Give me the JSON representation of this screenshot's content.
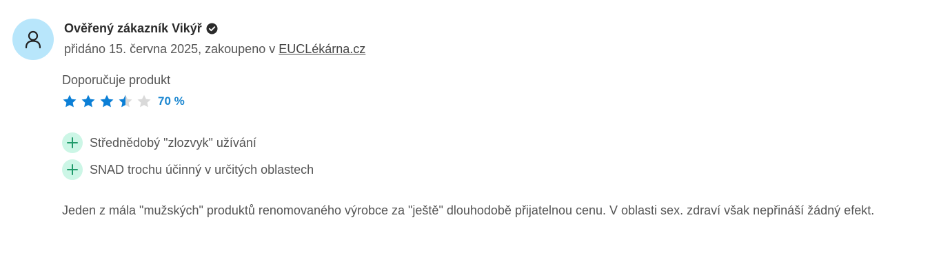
{
  "review": {
    "author": "Ověřený zákazník Vikýř",
    "meta_prefix": "přidáno 15. června 2025, zakoupeno v ",
    "store_link": "EUCLékárna.cz",
    "recommend_label": "Doporučuje produkt",
    "rating": {
      "stars_total": 5,
      "fraction": 0.7,
      "percent_label": "70 %",
      "filled_color": "#0b7fd6",
      "empty_color": "#d9d9d9"
    },
    "pros": [
      {
        "text": "Střednědobý \"zlozvyk\" užívání"
      },
      {
        "text": "SNAD trochu účinný v určitých oblastech"
      }
    ],
    "text": "Jeden z mála \"mužských\" produktů renomovaného výrobce za \"ještě\" dlouhodobě přijatelnou cenu. V oblasti sex. zdraví však nepřináší žádný efekt."
  },
  "icons": {
    "avatar": "user-icon",
    "verified": "verified-check-icon",
    "pro": "plus-icon",
    "star": "star-icon"
  }
}
